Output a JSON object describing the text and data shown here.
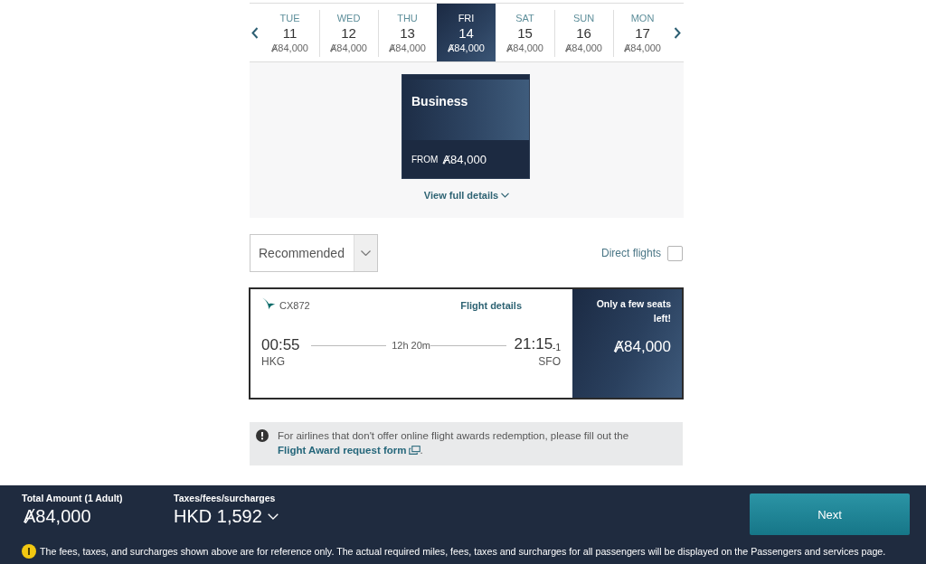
{
  "date_strip": {
    "days": [
      {
        "weekday": "TUE",
        "day": "11",
        "price": "Ⱥ84,000",
        "selected": false
      },
      {
        "weekday": "WED",
        "day": "12",
        "price": "Ⱥ84,000",
        "selected": false
      },
      {
        "weekday": "THU",
        "day": "13",
        "price": "Ⱥ84,000",
        "selected": false
      },
      {
        "weekday": "FRI",
        "day": "14",
        "price": "Ⱥ84,000",
        "selected": true
      },
      {
        "weekday": "SAT",
        "day": "15",
        "price": "Ⱥ84,000",
        "selected": false
      },
      {
        "weekday": "SUN",
        "day": "16",
        "price": "Ⱥ84,000",
        "selected": false
      },
      {
        "weekday": "MON",
        "day": "17",
        "price": "Ⱥ84,000",
        "selected": false
      }
    ]
  },
  "cabin_card": {
    "name": "Business",
    "from_label": "FROM",
    "price": "Ⱥ84,000"
  },
  "details_link": "View full details",
  "sort": {
    "value": "Recommended"
  },
  "direct_flights": {
    "label": "Direct flights",
    "checked": false
  },
  "flight": {
    "number": "CX872",
    "details_link": "Flight details",
    "depart_time": "00:55",
    "depart_airport": "HKG",
    "duration": "12h 20m",
    "arrive_time": "21:15$_{-1}$",
    "arrive_airport": "SFO",
    "availability": "Only a few seats left!",
    "price": "Ⱥ84,000"
  },
  "notice": {
    "text": "For airlines that don't offer online flight awards redemption, please fill out the",
    "link": "Flight Award request form",
    "end": "."
  },
  "footer": {
    "total_label": "Total Amount (1 Adult)",
    "total": "Ⱥ84,000",
    "taxes_label": "Taxes/fees/surcharges",
    "taxes": "HKD 1,592",
    "next": "Next",
    "disclaimer": "The fees, taxes, and surcharges shown above are for reference only. The actual required miles, fees, taxes and surcharges for all passengers will be displayed on the Passengers and services page."
  }
}
